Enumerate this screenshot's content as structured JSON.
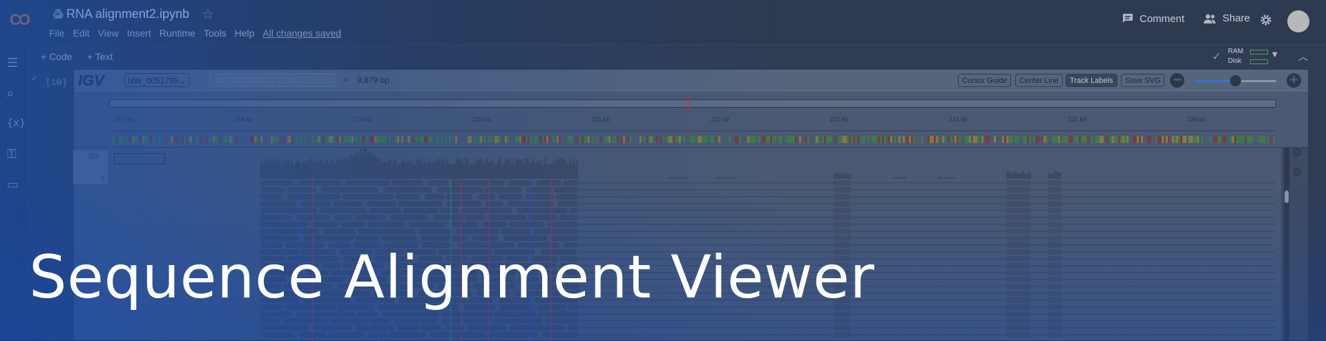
{
  "header": {
    "logo": "CO",
    "doc_title": "RNA alignment2.ipynb",
    "menu": [
      "File",
      "Edit",
      "View",
      "Insert",
      "Runtime",
      "Tools",
      "Help"
    ],
    "saved_status": "All changes saved",
    "comment_label": "Comment",
    "share_label": "Share"
  },
  "toolbar": {
    "code_label": "+ Code",
    "text_label": "+ Text",
    "ram_label": "RAM",
    "disk_label": "Disk"
  },
  "cell": {
    "exec_count": "[10]"
  },
  "igv": {
    "logo": "IGV",
    "chromosome": "NW_0051795",
    "locus_value": "NW_005179595.1:19,09…",
    "width_label": "9,879 bp",
    "buttons": [
      "Cursor Guide",
      "Center Line",
      "Track Labels",
      "Save SVG"
    ],
    "active_button": "Track Labels",
    "zoom_level": 0.5,
    "coverage_max": "112",
    "coverage_min": "0",
    "ruler_ticks": [
      "217 kb",
      "218 kb",
      "219 kb",
      "220 kb",
      "221 kb",
      "222 kb",
      "223 kb",
      "224 kb",
      "225 kb",
      "226 kb"
    ]
  },
  "banner": {
    "title": "Sequence Alignment Viewer"
  },
  "colors": {
    "accent_blue": "#1f5fc8",
    "ok_green": "#5fb86a",
    "mismatch_red": "#c0304a",
    "mismatch_green": "#3d9a4a",
    "mismatch_blue": "#3050d0"
  },
  "icons": {
    "rail": [
      "list-icon",
      "search-icon",
      "variables-icon",
      "key-icon",
      "folder-icon"
    ]
  }
}
